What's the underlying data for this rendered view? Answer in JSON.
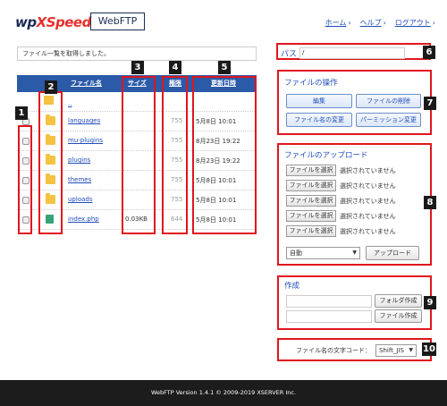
{
  "header": {
    "logo_wp": "wp",
    "logo_x": "X",
    "logo_speed": "Speed",
    "product": "WebFTP",
    "nav": [
      {
        "label": "ホーム"
      },
      {
        "label": "ヘルプ"
      },
      {
        "label": "ログアウト"
      }
    ],
    "nav_arrow": "›"
  },
  "status_message": "ファイル一覧を取得しました。",
  "table": {
    "headers": {
      "name": "ファイル名",
      "size": "サイズ",
      "perm": "権限",
      "date": "更新日時"
    },
    "parent_link": "..",
    "rows": [
      {
        "name": "languages",
        "size": "",
        "perm": "755",
        "date": "5月8日 10:01",
        "icon": "folder-icon"
      },
      {
        "name": "mu-plugins",
        "size": "",
        "perm": "755",
        "date": "8月23日 19:22",
        "icon": "folder-icon"
      },
      {
        "name": "plugins",
        "size": "",
        "perm": "755",
        "date": "8月23日 19:22",
        "icon": "folder-icon"
      },
      {
        "name": "themes",
        "size": "",
        "perm": "755",
        "date": "5月8日 10:01",
        "icon": "folder-icon"
      },
      {
        "name": "uploads",
        "size": "",
        "perm": "755",
        "date": "5月8日 10:01",
        "icon": "folder-icon"
      },
      {
        "name": "index.php",
        "size": "0.03KB",
        "perm": "644",
        "date": "5月8日 10:01",
        "icon": "php-file-icon"
      }
    ]
  },
  "path": {
    "label": "パス",
    "value": "/"
  },
  "operations": {
    "title": "ファイルの操作",
    "edit": "編集",
    "delete": "ファイルの削除",
    "rename": "ファイル名の変更",
    "permission": "パーミッション変更"
  },
  "upload": {
    "title": "ファイルのアップロード",
    "choose": "ファイルを選択",
    "none": "選択されていません",
    "mode": "自動",
    "submit": "アップロード"
  },
  "create": {
    "title": "作成",
    "folder_btn": "フォルダ作成",
    "file_btn": "ファイル作成"
  },
  "encoding": {
    "label": "ファイル名の文字コード：",
    "value": "Shift_JIS"
  },
  "badges": [
    "1",
    "2",
    "3",
    "4",
    "5",
    "6",
    "7",
    "8",
    "9",
    "10"
  ],
  "footer": "WebFTP Version 1.4.1  © 2009-2019 XSERVER Inc.",
  "colors": {
    "accent": "#1f4db8",
    "header_bar": "#2a5aa8",
    "highlight": "#e0161d",
    "brand_red": "#e4312b"
  }
}
